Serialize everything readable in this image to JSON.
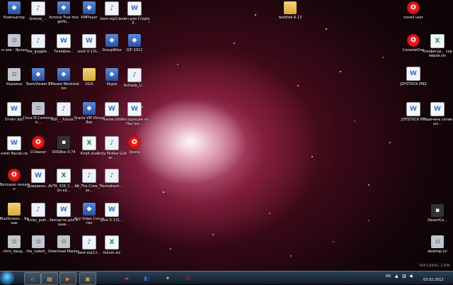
{
  "desktop": {
    "icons": [
      {
        "label": "Компьютер",
        "type": "app"
      },
      {
        "label": "Groove_...",
        "type": "audio"
      },
      {
        "label": "Acronis True ImageHo...",
        "type": "app"
      },
      {
        "label": "KMPlayer",
        "type": "app"
      },
      {
        "label": "best-mp3.t...",
        "type": "audio"
      },
      {
        "label": "ключ для CryptoP...",
        "type": "doc"
      },
      {
        "label": "rc.exe - Ярлык",
        "type": "gray"
      },
      {
        "label": "the_guggle...",
        "type": "audio"
      },
      {
        "label": "Телефон...",
        "type": "doc"
      },
      {
        "label": "post-3-131...",
        "type": "doc"
      },
      {
        "label": "GroupWise",
        "type": "app"
      },
      {
        "label": "QIP 2012",
        "type": "app"
      },
      {
        "label": "Корзина",
        "type": "gray"
      },
      {
        "label": "TeamViewer 8",
        "type": "app"
      },
      {
        "label": "VMware Workstation",
        "type": "app"
      },
      {
        "label": "2GIS",
        "type": "folder"
      },
      {
        "label": "Skype",
        "type": "app"
      },
      {
        "label": "Astrada_Li...",
        "type": "audio"
      },
      {
        "label": "Отчёт.doc",
        "type": "doc"
      },
      {
        "label": "Cisco IP Communic...",
        "type": "gray"
      },
      {
        "label": "stdt_-_future...",
        "type": "audio"
      },
      {
        "label": "Oracle VM VirtualBox",
        "type": "app"
      },
      {
        "label": "medw.cdn",
        "type": "doc"
      },
      {
        "label": "Инструкция по Настро...",
        "type": "doc"
      },
      {
        "label": "комп Васяв.ла",
        "type": "doc"
      },
      {
        "label": "CCleaner",
        "type": "red"
      },
      {
        "label": "DOSBox-0.74",
        "type": "dark"
      },
      {
        "label": "Клуб.xlsx",
        "type": "xls"
      },
      {
        "label": "Andy McKee Guitar...",
        "type": "audio"
      },
      {
        "label": "Opera",
        "type": "red"
      },
      {
        "label": "Фотошоп онлайн",
        "type": "red"
      },
      {
        "label": "Доверенн...",
        "type": "doc"
      },
      {
        "label": "AVTA_338_C... план ка...",
        "type": "xls"
      },
      {
        "label": "10_The Crew_Thas...",
        "type": "audio"
      },
      {
        "label": "comeback...",
        "type": "audio"
      },
      {
        "label": "BlueScreen... Ярлык",
        "type": "folder"
      },
      {
        "label": "funky_pott...",
        "type": "audio"
      },
      {
        "label": "Запчасти для маши...",
        "type": "doc"
      },
      {
        "label": "Any Video Converter",
        "type": "app"
      },
      {
        "label": "post-3-131...",
        "type": "doc"
      },
      {
        "label": "chris_daug...",
        "type": "gray"
      },
      {
        "label": "the_naked_...",
        "type": "gray"
      },
      {
        "label": "Download Master",
        "type": "gray"
      },
      {
        "label": "best-mp3.t...",
        "type": "audio"
      },
      {
        "label": "folium.xls",
        "type": "xls"
      },
      {
        "label": "testdisk-6.13",
        "type": "folder"
      },
      {
        "label": "novell user",
        "type": "red"
      },
      {
        "label": "ConsoleOne",
        "type": "red"
      },
      {
        "label": "JOYSTOCK PMZ",
        "type": "doc"
      },
      {
        "label": "Конфигур... сервёров.xls",
        "type": "xls"
      },
      {
        "label": "JOYSTOCK PM",
        "type": "doc"
      },
      {
        "label": "Перечень сетевых...",
        "type": "doc"
      },
      {
        "label": "DesertCo...",
        "type": "dark"
      },
      {
        "label": "desktop.ini",
        "type": "gray"
      },
      {
        "label": "desktop.ini",
        "type": "gray"
      }
    ]
  },
  "taskbar": {
    "pinned": [
      {
        "name": "ie-icon",
        "glyph": "e",
        "color": "#3a8ee6"
      },
      {
        "name": "explorer-folder-icon",
        "glyph": "▤",
        "color": "#e6c15a"
      },
      {
        "name": "media-player-icon",
        "glyph": "▶",
        "color": "#e07a2a"
      },
      {
        "name": "toolbox-icon",
        "glyph": "▣",
        "color": "#c8a050"
      },
      {
        "name": "app-red-icon",
        "glyph": "▰",
        "color": "#d04030"
      },
      {
        "name": "network-icon",
        "glyph": "◧",
        "color": "#3a70c8"
      },
      {
        "name": "puzzle-icon",
        "glyph": "✦",
        "color": "#e0c030"
      },
      {
        "name": "opera-icon",
        "glyph": "O",
        "color": "#e02020"
      }
    ],
    "lang": "EN",
    "date": "03.02.2012"
  },
  "watermark": "YAPLAKAL.COM"
}
